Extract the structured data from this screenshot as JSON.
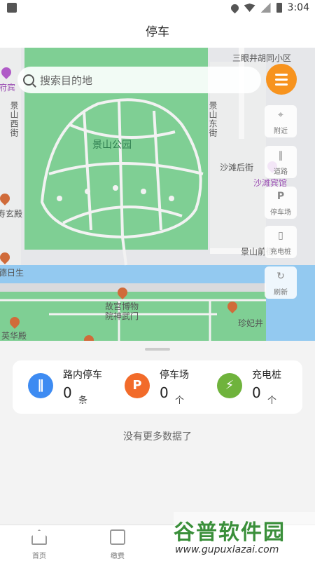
{
  "status_bar": {
    "time": "3:04"
  },
  "header": {
    "title": "停车"
  },
  "search": {
    "placeholder": "搜索目的地"
  },
  "map": {
    "labels": {
      "park": "景山公园",
      "top_right": "三眼井胡同小区",
      "west_street": "景山西街",
      "east_street": "景山东街",
      "shatan": "沙滩后街",
      "hotel": "沙滩宾馆",
      "left_top": "府宾",
      "left_hall": "寿玄殿",
      "left_bottom": "德日生",
      "museum": "故宫博物院神武门",
      "zhenfei": "珍妃井",
      "yinghua": "英华殿",
      "jingshan_front": "景山前街"
    }
  },
  "tools": {
    "nearby": "附近",
    "road": "道路",
    "parking_lot": "停车场",
    "charging": "充电桩",
    "refresh": "刷新"
  },
  "stats": [
    {
      "label": "路内停车",
      "value": "0",
      "unit": "条",
      "color": "#3d8bf2",
      "icon": "road-icon"
    },
    {
      "label": "停车场",
      "value": "0",
      "unit": "个",
      "color": "#f26b2a",
      "icon": "P"
    },
    {
      "label": "充电桩",
      "value": "0",
      "unit": "个",
      "color": "#6fb33c",
      "icon": "charger-icon"
    }
  ],
  "no_more": "没有更多数据了",
  "tabbar": {
    "home": "首页",
    "fee": "缴费"
  },
  "watermark": {
    "brand": "谷普软件园",
    "url": "www.gupuxlazai.com"
  }
}
